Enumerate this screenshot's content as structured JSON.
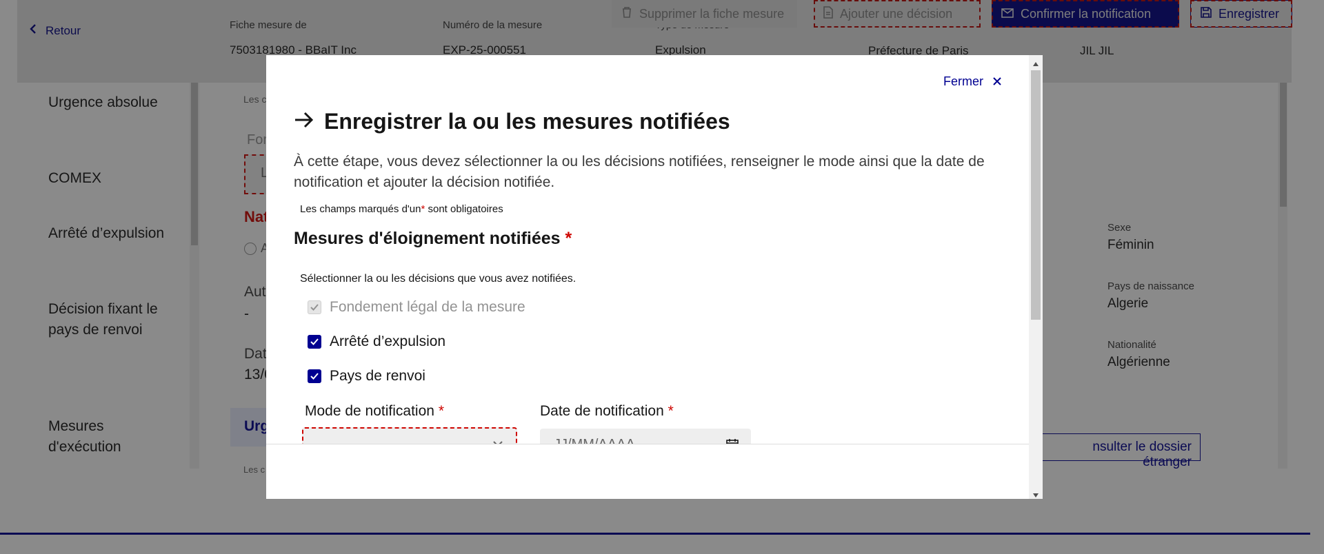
{
  "header": {
    "back_label": "Retour",
    "meta": [
      {
        "label": "Fiche mesure de",
        "value": "7503181980 - BBaIT Inc"
      },
      {
        "label": "Numéro de la mesure",
        "value": "EXP-25-000551"
      },
      {
        "label": "Type de mesure",
        "value": "Expulsion"
      },
      {
        "label": "",
        "value": "Préfecture de Paris"
      },
      {
        "label": "",
        "value": "JIL JIL"
      }
    ],
    "actions": {
      "delete": "Supprimer la fiche mesure",
      "add_decision": "Ajouter une décision",
      "confirm": "Confirmer la notification",
      "save": "Enregistrer"
    }
  },
  "sidebar": {
    "items": [
      {
        "label": "Urgence absolue"
      },
      {
        "label": "COMEX"
      },
      {
        "label": "Arrêté d’expulsion"
      },
      {
        "label": "Décision fixant le pays de renvoi"
      },
      {
        "label": "Mesures d'exécution"
      }
    ]
  },
  "main": {
    "fragments": {
      "f1": "Les c",
      "f2": "For",
      "f3": "L",
      "f4": "Nat",
      "f5": "A",
      "f6": "Aut",
      "f7": "-",
      "f8": "Dat",
      "f9": "13/0",
      "f10": "Urg",
      "f11": "Les c"
    },
    "person": [
      {
        "label": "Sexe",
        "value": "Féminin"
      },
      {
        "label": "Pays de naissance",
        "value": "Algerie"
      },
      {
        "label": "Nationalité",
        "value": "Algérienne"
      }
    ],
    "consult_button": "nsulter le dossier étranger"
  },
  "modal": {
    "close_label": "Fermer",
    "title": "Enregistrer la ou les mesures notifiées",
    "description": "À cette étape, vous devez sélectionner la ou les décisions notifiées, renseigner le mode ainsi que la date de notification et ajouter la décision notifiée.",
    "required_note_pre": "Les champs marqués d'un",
    "required_note_star": "*",
    "required_note_post": "sont obligatoires",
    "section_title": "Mesures d'éloignement notifiées",
    "section_star": "*",
    "hint": "Sélectionner la ou les décisions que vous avez notifiées.",
    "checkboxes": [
      {
        "label": "Fondement légal de la mesure",
        "checked": true,
        "disabled": true
      },
      {
        "label": "Arrêté d’expulsion",
        "checked": true,
        "disabled": false
      },
      {
        "label": "Pays de renvoi",
        "checked": true,
        "disabled": false
      }
    ],
    "mode_label": "Mode de notification",
    "mode_star": "*",
    "date_label": "Date de notification",
    "date_star": "*",
    "date_placeholder": "JJ/MM/AAAA"
  },
  "colors": {
    "primary": "#000091",
    "error": "#ce0500"
  }
}
